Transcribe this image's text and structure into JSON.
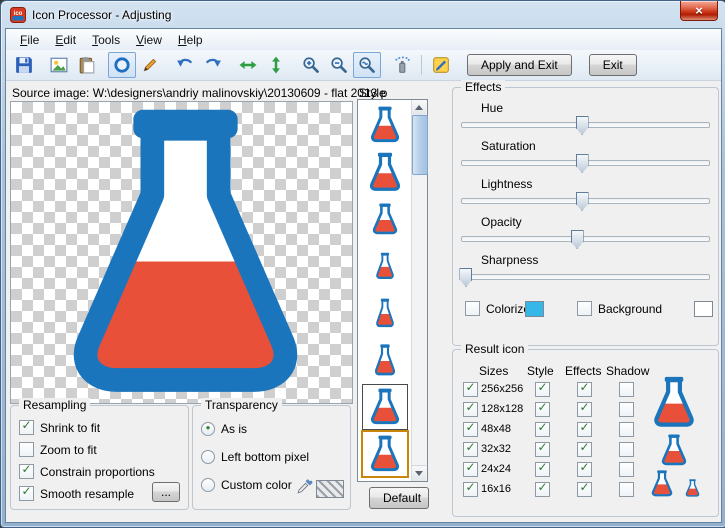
{
  "window": {
    "title": "Icon Processor - Adjusting",
    "close_glyph": "×"
  },
  "menu": {
    "items": [
      "File",
      "Edit",
      "Tools",
      "View",
      "Help"
    ]
  },
  "toolbar": {
    "icons": [
      "save",
      "open-image",
      "paste",
      "circle-shape",
      "pencil",
      "undo",
      "redo",
      "resize-horizontal",
      "resize-vertical",
      "zoom-in",
      "zoom-out",
      "zoom-actual",
      "spray",
      "adjustments"
    ],
    "selected_icons": [
      "circle-shape",
      "zoom-actual"
    ],
    "apply_and_exit": "Apply and Exit",
    "exit": "Exit"
  },
  "source_image": {
    "label": "Source image: W:\\designers\\andriy malinovskiy\\20130609 - flat 2013 p"
  },
  "style_panel": {
    "label": "Style",
    "default_button": "Default",
    "item_count": 8,
    "selected_index": 6
  },
  "effects": {
    "title": "Effects",
    "sliders": [
      {
        "label": "Hue",
        "value": 48
      },
      {
        "label": "Saturation",
        "value": 48
      },
      {
        "label": "Lightness",
        "value": 48
      },
      {
        "label": "Opacity",
        "value": 46
      },
      {
        "label": "Sharpness",
        "value": 1
      }
    ],
    "colorize": {
      "label": "Colorize",
      "check": "",
      "swatch": "#35b8e8"
    },
    "background": {
      "label": "Background",
      "check": "",
      "swatch": "#ffffff"
    }
  },
  "result_icon": {
    "title": "Result icon",
    "headers": [
      "Sizes",
      "Style",
      "Effects",
      "Shadow"
    ],
    "rows": [
      {
        "size": "256x256",
        "size_check": "✓",
        "style_check": "✓",
        "effects_check": "✓",
        "shadow_check": ""
      },
      {
        "size": "128x128",
        "size_check": "✓",
        "style_check": "✓",
        "effects_check": "✓",
        "shadow_check": ""
      },
      {
        "size": "48x48",
        "size_check": "✓",
        "style_check": "✓",
        "effects_check": "✓",
        "shadow_check": ""
      },
      {
        "size": "32x32",
        "size_check": "✓",
        "style_check": "✓",
        "effects_check": "✓",
        "shadow_check": ""
      },
      {
        "size": "24x24",
        "size_check": "✓",
        "style_check": "✓",
        "effects_check": "✓",
        "shadow_check": ""
      },
      {
        "size": "16x16",
        "size_check": "✓",
        "style_check": "✓",
        "effects_check": "✓",
        "shadow_check": ""
      }
    ]
  },
  "resampling": {
    "title": "Resampling",
    "options": [
      {
        "label": "Shrink to fit",
        "check": "✓"
      },
      {
        "label": "Zoom to fit",
        "check": ""
      },
      {
        "label": "Constrain proportions",
        "check": "✓"
      },
      {
        "label": "Smooth resample",
        "check": "✓"
      }
    ],
    "more_button": "..."
  },
  "transparency": {
    "title": "Transparency",
    "options": [
      {
        "label": "As is",
        "dot": "●"
      },
      {
        "label": "Left bottom pixel",
        "dot": ""
      },
      {
        "label": "Custom color",
        "dot": ""
      }
    ]
  }
}
